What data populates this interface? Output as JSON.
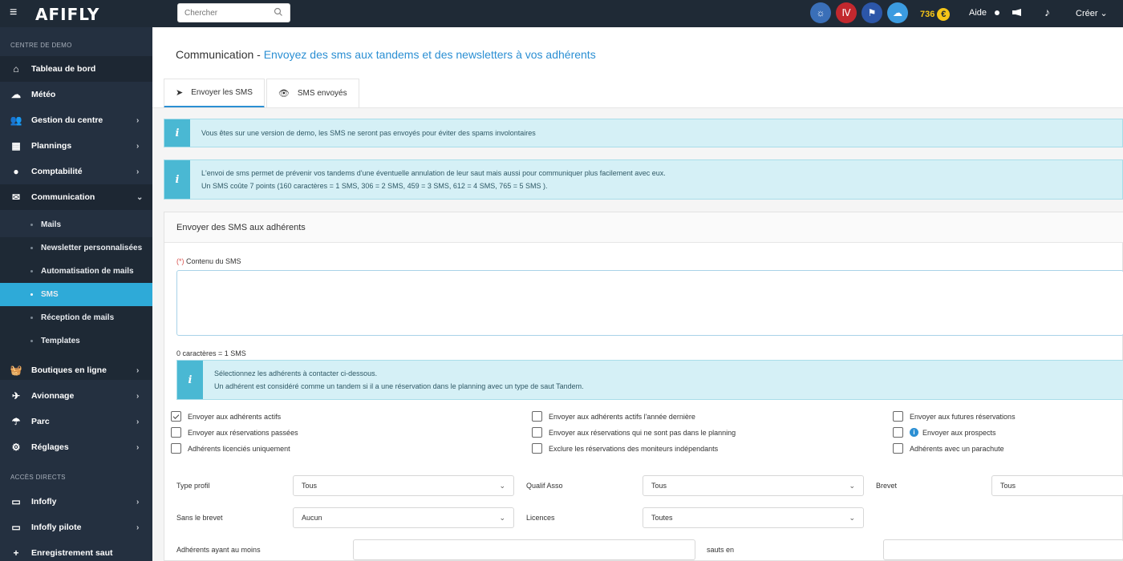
{
  "topbar": {
    "logo": "AFIFLY",
    "search_placeholder": "Chercher",
    "points": "736",
    "aide": "Aide",
    "creer": "Créer ⌄"
  },
  "sidebar": {
    "section1": "CENTRE DE DEMO",
    "section2": "ACCÈS DIRECTS",
    "items": [
      {
        "label": "Tableau de bord",
        "icon": "home-icon"
      },
      {
        "label": "Météo",
        "icon": "cloud-icon"
      },
      {
        "label": "Gestion du centre",
        "icon": "users-icon"
      },
      {
        "label": "Plannings",
        "icon": "calendar-icon"
      },
      {
        "label": "Comptabilité",
        "icon": "piggy-bank-icon"
      },
      {
        "label": "Communication",
        "icon": "envelope-icon"
      },
      {
        "label": "Boutiques en ligne",
        "icon": "basket-icon"
      },
      {
        "label": "Avionnage",
        "icon": "plane-icon"
      },
      {
        "label": "Parc",
        "icon": "parachute-icon"
      },
      {
        "label": "Réglages",
        "icon": "gear-icon"
      }
    ],
    "sub_items": [
      "Mails",
      "Newsletter personnalisées",
      "Automatisation de mails",
      "SMS",
      "Réception de mails",
      "Templates"
    ],
    "direct_items": [
      {
        "label": "Infofly",
        "icon": "monitor-icon"
      },
      {
        "label": "Infofly pilote",
        "icon": "monitor-icon"
      },
      {
        "label": "Enregistrement saut",
        "icon": "plus-icon"
      }
    ]
  },
  "main": {
    "title": "Communication - ",
    "subtitle": "Envoyez des sms aux tandems et des newsletters à vos adhérents",
    "tabs": [
      "Envoyer les SMS",
      "SMS envoyés"
    ],
    "alert1": "Vous êtes sur une version de demo, les SMS ne seront pas envoyés pour éviter des spams involontaires",
    "alert2_line1": "L'envoi de sms permet de prévenir vos tandems d'une éventuelle annulation de leur saut mais aussi pour communiquer plus facilement avec eux.",
    "alert2_line2": "Un SMS coûte 7 points (160 caractères = 1 SMS, 306 = 2 SMS, 459 = 3 SMS, 612 = 4 SMS, 765 = 5 SMS ).",
    "panel_title": "Envoyer des SMS aux adhérents",
    "required_mark": "(*)",
    "content_label": "Contenu du SMS",
    "char_count": "0 caractères = 1 SMS",
    "alert3_line1": "Sélectionnez les adhérents à contacter ci-dessous.",
    "alert3_line2": "Un adhérent est considéré comme un tandem si il a une réservation dans le planning avec un type de saut Tandem.",
    "checkboxes": [
      {
        "label": "Envoyer aux adhérents actifs",
        "checked": true
      },
      {
        "label": "Envoyer aux adhérents actifs l'année dernière",
        "checked": false
      },
      {
        "label": "Envoyer aux futures réservations",
        "checked": false
      },
      {
        "label": "Envoyer aux réservations passées",
        "checked": false
      },
      {
        "label": "Envoyer aux réservations qui ne sont pas dans le planning",
        "checked": false
      },
      {
        "label": "Envoyer aux prospects",
        "checked": false
      },
      {
        "label": "Adhérents licenciés uniquement",
        "checked": false
      },
      {
        "label": "Exclure les réservations des moniteurs indépendants",
        "checked": false
      },
      {
        "label": "Adhérents avec un parachute",
        "checked": false
      }
    ],
    "filters": {
      "type_profil_label": "Type profil",
      "type_profil_value": "Tous",
      "qualif_label": "Qualif Asso",
      "qualif_value": "Tous",
      "brevet_label": "Brevet",
      "brevet_value": "Tous",
      "sans_brevet_label": "Sans le brevet",
      "sans_brevet_value": "Aucun",
      "licences_label": "Licences",
      "licences_value": "Toutes",
      "au_moins_label": "Adhérents ayant au moins",
      "sauts_en_label": "sauts en"
    }
  }
}
